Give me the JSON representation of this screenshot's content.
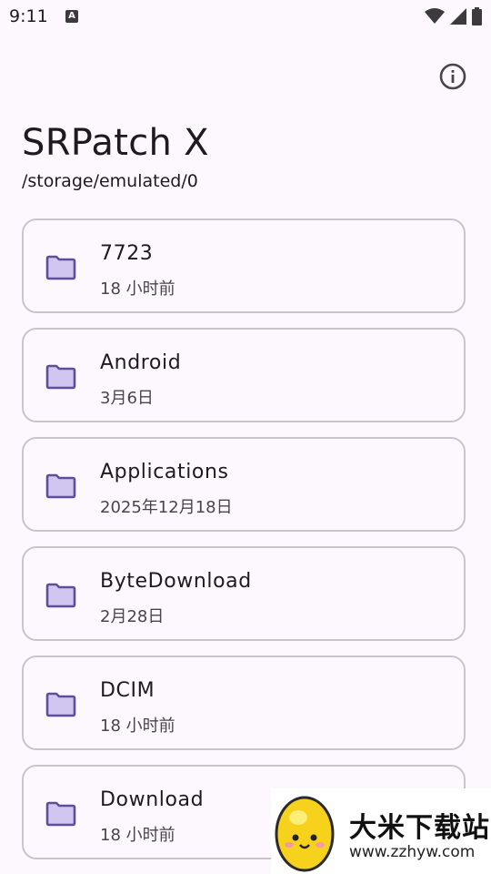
{
  "status_bar": {
    "time": "9:11",
    "notification_badge": "A",
    "icons": [
      "wifi-icon",
      "signal-icon",
      "battery-icon"
    ]
  },
  "header": {
    "title": "SRPatch X",
    "path": "/storage/emulated/0",
    "info_icon": "info-icon"
  },
  "folders": [
    {
      "name": "7723",
      "date": "18 小时前"
    },
    {
      "name": "Android",
      "date": "3月6日"
    },
    {
      "name": "Applications",
      "date": "2025年12月18日"
    },
    {
      "name": "ByteDownload",
      "date": "2月28日"
    },
    {
      "name": "DCIM",
      "date": "18 小时前"
    },
    {
      "name": "Download",
      "date": "18 小时前"
    }
  ],
  "watermark": {
    "title": "大米下载站",
    "url": "www.zzhyw.com"
  },
  "colors": {
    "background": "#fdf7fe",
    "card_border": "#cac4d0",
    "folder_fill": "#d0c6ef",
    "folder_stroke": "#5d4f9a"
  }
}
